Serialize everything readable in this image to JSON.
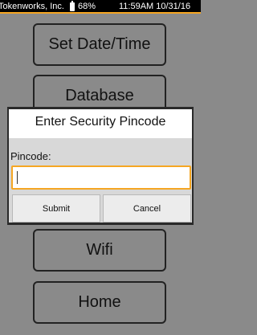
{
  "status_bar": {
    "carrier": "Tokenworks, Inc.",
    "battery_icon": "battery-icon",
    "battery": "68%",
    "clock": "11:59AM 10/31/16",
    "accent_color": "#f5a623"
  },
  "menu": {
    "items": [
      {
        "label": "Set Date/Time"
      },
      {
        "label": "Database"
      },
      {
        "label": ""
      },
      {
        "label": "Wifi"
      },
      {
        "label": "Home"
      }
    ]
  },
  "dialog": {
    "title": "Enter Security Pincode",
    "field_label": "Pincode:",
    "field_value": "",
    "field_placeholder": "",
    "submit_label": "Submit",
    "cancel_label": "Cancel",
    "focus_color": "#f5a623"
  }
}
